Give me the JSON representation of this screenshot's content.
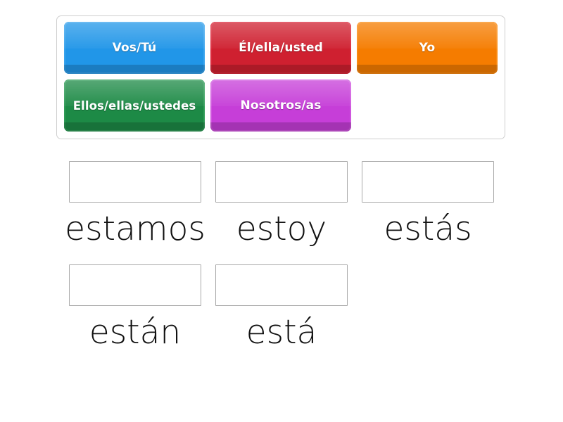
{
  "source_panel": {
    "name": "pronoun-tiles-panel",
    "rows": [
      [
        {
          "label": "Vos/Tú",
          "color": "#2196e8",
          "variant": "blue"
        },
        {
          "label": "Él/ella/usted",
          "color": "#cf2030",
          "variant": "red"
        },
        {
          "label": "Yo",
          "color": "#f57c00",
          "variant": "orange"
        }
      ],
      [
        {
          "label": "Ellos/ellas/ustedes",
          "color": "#1d8a46",
          "variant": "green"
        },
        {
          "label": "Nosotros/as",
          "color": "#c63ed8",
          "variant": "purple"
        }
      ]
    ]
  },
  "answer_area": {
    "rows": [
      [
        {
          "box_value": "",
          "word": "estamos"
        },
        {
          "box_value": "",
          "word": "estoy"
        },
        {
          "box_value": "",
          "word": "estás"
        }
      ],
      [
        {
          "box_value": "",
          "word": "están"
        },
        {
          "box_value": "",
          "word": "está"
        }
      ]
    ]
  },
  "colors": {
    "background": "#ffffff",
    "panel_border": "#cfcfcf",
    "box_border": "#a9a9a9",
    "word_text": "#111111",
    "tile_text": "#ffffff"
  }
}
